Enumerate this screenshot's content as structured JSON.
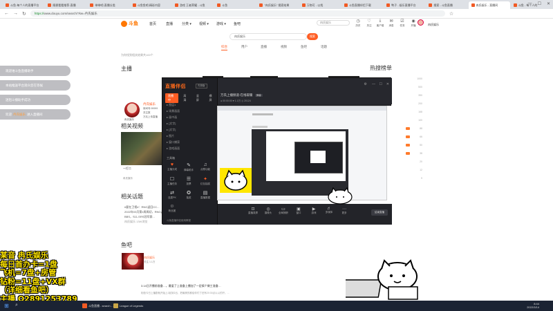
{
  "browser": {
    "tabs": [
      {
        "title": "斗鱼-每个人的直播平台"
      },
      {
        "title": "随便看看推荐-直播"
      },
      {
        "title": "带带吧-直播分类"
      },
      {
        "title": "斗鱼鱼吧-精彩内容"
      },
      {
        "title": "游戏 王者荣耀 - 斗鱼"
      },
      {
        "title": "斗鱼"
      },
      {
        "title": "\"冉氏娱乐\" 搜索结果"
      },
      {
        "title": "万物可 - 以找"
      },
      {
        "title": "斗鱼直播伴侣下载"
      },
      {
        "title": "鸭子 - 娱乐直播平台"
      },
      {
        "title": "搜索 - 斗鱼直播"
      },
      {
        "title": "冉氏娱乐 - 直播间"
      },
      {
        "title": "斗鱼 - 每个人的"
      }
    ],
    "url_prefix": "https://",
    "url": "www.douyu.com/search/?kw=冉氏娱乐"
  },
  "site": {
    "logo": "斗鱼",
    "nav": [
      "首页",
      "直播",
      "分类 ▾",
      "视频 ▾",
      "游戏 ▾",
      "鱼吧"
    ],
    "top_search_placeholder": "冉氏娱乐",
    "right_icons": [
      {
        "icon": "history-icon",
        "label": "历史"
      },
      {
        "icon": "follow-icon",
        "label": "关注"
      },
      {
        "icon": "download-icon",
        "label": "客户端"
      },
      {
        "icon": "message-icon",
        "label": "消息"
      },
      {
        "icon": "task-icon",
        "label": "任务"
      },
      {
        "icon": "broadcast-icon",
        "label": "开播"
      }
    ],
    "user_label": "冉氏娱乐",
    "search_value": "冉氏娱乐",
    "search_button": "搜索",
    "result_tabs": [
      "综合",
      "用户",
      "直播",
      "视频",
      "鱼吧",
      "话题"
    ],
    "result_info": "为你找到相关结果共100个",
    "sections": {
      "anchor": "主播",
      "related_video": "相关视频",
      "related_topic": "相关话题",
      "fishbar": "鱼吧",
      "hot_rank": "热搜榜单"
    },
    "anchor": {
      "name": "冉氏娱乐",
      "line1": "房间号:99999",
      "line2": "关注数",
      "line3": "万兆上传直播",
      "sub": "冉氏娱乐"
    },
    "video": {
      "caption": "一打二",
      "meta": "冉氏娱乐"
    },
    "topics": [
      {
        "text": "#要在卫视#：RNG返回CC...",
        "dim": false
      },
      {
        "text": "2022年03月第4周周初，RNG返",
        "dim": false
      },
      {
        "text": "BBS，S11-SRS冠军赛...",
        "dim": false
      },
      {
        "text": "冉氏娱乐  13W浏览",
        "dim": true
      }
    ],
    "fishbar": {
      "name": "冉氏娱乐",
      "meta": "关注 1.1万"
    },
    "posts": [
      {
        "text": "3.14日开播前准备…，最爱了上准备上播加了一定搞个做工准备…",
        "dim": false
      },
      {
        "text": "相信今日上播剧就开始上2起到2出，把最美的都给你们了还有20:30点以以的开，...",
        "dim": true
      }
    ],
    "rank_values": [
      "1000",
      "500",
      "350",
      "200",
      "168",
      "100",
      "88",
      "66",
      "50",
      "38",
      "20",
      "12",
      "9"
    ]
  },
  "notices": [
    {
      "text": "观迎谁斗鱼直播助手",
      "hl": "",
      "tail": ""
    },
    {
      "text": "本站推送平台观众您在等候",
      "hl": "",
      "tail": ""
    },
    {
      "text": "迷阻斗播助手成功",
      "hl": "",
      "tail": ""
    },
    {
      "text": "欢迎",
      "hl": "冉氏娱乐",
      "tail": "进入直播间"
    }
  ],
  "stream_app": {
    "logo_a": "直播伴侣",
    "logo_b": "",
    "version": "内测版",
    "tabs": [
      "直播中",
      "高清",
      "竖屏",
      "横屏"
    ],
    "scenes": [
      "▸ 图层1",
      "▸ 场景画面",
      "▸ 画中画",
      "▸ [文字]",
      "▸ [文字]",
      "▸ 图片",
      "▸ 窗口捕获",
      "▸ 游戏画面"
    ],
    "toolbox_title": "工具箱",
    "tools": [
      {
        "icon": "gift-icon",
        "label": "主播分成",
        "red": true
      },
      {
        "icon": "chat-icon",
        "label": "弹幕助手",
        "red": false
      },
      {
        "icon": "music-icon",
        "label": "点歌功能",
        "red": false
      },
      {
        "icon": "bag-icon",
        "label": "主播任务",
        "red": false
      },
      {
        "icon": "vote-icon",
        "label": "投票",
        "red": false
      },
      {
        "icon": "red-icon",
        "label": "红包抽奖",
        "red": true
      },
      {
        "icon": "pk-icon",
        "label": "连麦PK",
        "red": false
      },
      {
        "icon": "lottery-icon",
        "label": "抽奖",
        "red": false
      },
      {
        "icon": "data-icon",
        "label": "直播数据",
        "red": false
      },
      {
        "icon": "fans-icon",
        "label": "粉丝团",
        "red": false
      }
    ],
    "bottom_link": "斗鱼直播伴侣使用教程",
    "title": "万氏上播频道-在线取暖",
    "title_tag": "弹幕",
    "stats": "● 00:00:00   ♥ 1.1万   ◎ 20124",
    "controls": [
      {
        "icon": "record-icon",
        "label": "直播录屏"
      },
      {
        "icon": "camera-icon",
        "label": "摄像头"
      },
      {
        "icon": "screen-icon",
        "label": "全局捕获"
      },
      {
        "icon": "window-icon",
        "label": "窗口"
      },
      {
        "icon": "game-icon",
        "label": "游戏"
      },
      {
        "icon": "video-icon",
        "label": "多媒体"
      },
      {
        "icon": "more-icon",
        "label": "更多"
      }
    ],
    "live_button": "结束直播"
  },
  "promo_lines": [
    "某音  冉氏娱乐",
    "每日首办卡=1盘",
    "飞机=7盘+房管",
    "钻粉=11盘+VX群",
    "（详细看鱼吧）",
    "主播 Q2891253789"
  ],
  "taskbar": {
    "items": [
      {
        "label": "斗鱼直播 - search - ...",
        "color": "#f15a24"
      },
      {
        "label": "League of Legends",
        "color": "#c8a548"
      }
    ],
    "time": "8:44",
    "date": "2022/3/14"
  }
}
